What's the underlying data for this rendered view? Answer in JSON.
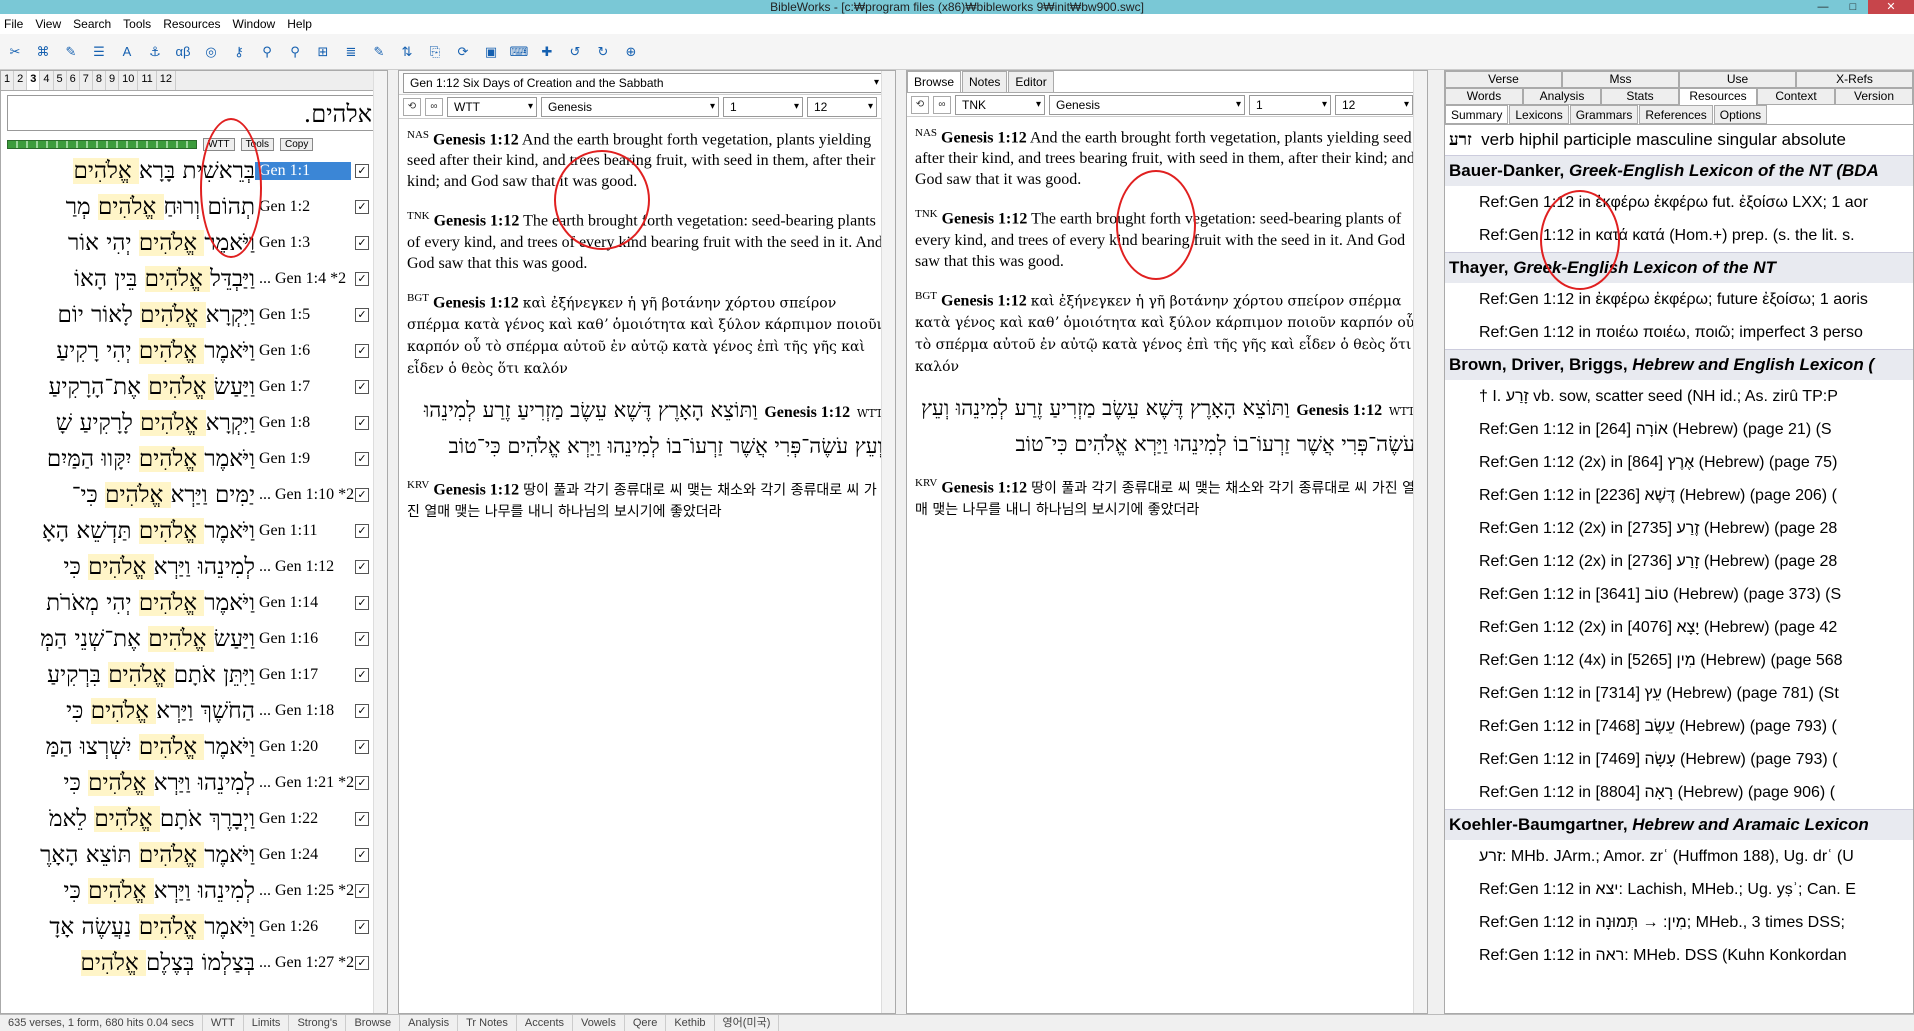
{
  "window": {
    "title": "BibleWorks - [c:₩program files (x86)₩bibleworks 9₩init₩bw900.swc]"
  },
  "menu": [
    "File",
    "View",
    "Search",
    "Tools",
    "Resources",
    "Window",
    "Help"
  ],
  "pane1": {
    "tabs": [
      "1",
      "2",
      "3",
      "4",
      "5",
      "6",
      "7",
      "8",
      "9",
      "10",
      "11",
      "12"
    ],
    "command": "אלהים.",
    "tools_label": "Tools",
    "copy_label": "Copy",
    "version_label": "WTT",
    "rows": [
      {
        "heb": "בְּרֵאשִׁית בָּרָא אֱלֹהִים",
        "ref": "Gen 1:1",
        "checked": true,
        "selected": true
      },
      {
        "heb": "תְהוֹם וְרוּחַ אֱלֹהִים מְרַ",
        "ref": "Gen 1:2",
        "checked": true
      },
      {
        "heb": "וַיֹּאמֶר אֱלֹהִים יְהִי אוֹר",
        "ref": "Gen 1:3",
        "checked": true
      },
      {
        "heb": "וַיַּבְדֵּל אֱלֹהִים בֵּין הָאוֹ",
        "ref": "... Gen 1:4 *2",
        "checked": true
      },
      {
        "heb": "וַיִּקְרָא אֱלֹהִים לָאוֹר יוֹם",
        "ref": "Gen 1:5",
        "checked": true
      },
      {
        "heb": "וַיֹּאמֶר אֱלֹהִים יְהִי רָקִיעַ",
        "ref": "Gen 1:6",
        "checked": true
      },
      {
        "heb": "וַיַּעַשׂ אֱלֹהִים אֶת־הָרָקִיעַ",
        "ref": "Gen 1:7",
        "checked": true
      },
      {
        "heb": "וַיִּקְרָא אֱלֹהִים לָרָקִיעַ שָׁ",
        "ref": "Gen 1:8",
        "checked": true
      },
      {
        "heb": "וַיֹּאמֶר אֱלֹהִים יִקָּווּ הַמַּיִם",
        "ref": "Gen 1:9",
        "checked": true
      },
      {
        "heb": "יַמִּים וַיַּרְא אֱלֹהִים כִּי־",
        "ref": "... Gen 1:10 *2",
        "checked": true
      },
      {
        "heb": "וַיֹּאמֶר אֱלֹהִים תַּדְשֵׁא הָאָ",
        "ref": "Gen 1:11",
        "checked": true
      },
      {
        "heb": "לְמִינֵהוּ וַיַּרְא אֱלֹהִים כִּי",
        "ref": "... Gen 1:12",
        "checked": true
      },
      {
        "heb": "וַיֹּאמֶר אֱלֹהִים יְהִי מְאֹרֹת",
        "ref": "Gen 1:14",
        "checked": true
      },
      {
        "heb": "וַיַּעַשׂ אֱלֹהִים אֶת־שְׁנֵי הַמְּ",
        "ref": "Gen 1:16",
        "checked": true
      },
      {
        "heb": "וַיִּתֵּן אֹתָם אֱלֹהִים בִּרְקִיעַ",
        "ref": "Gen 1:17",
        "checked": true
      },
      {
        "heb": "הַחֹשֶׁךְ וַיַּרְא אֱלֹהִים כִּי",
        "ref": "... Gen 1:18",
        "checked": true
      },
      {
        "heb": "וַיֹּאמֶר אֱלֹהִים יִשְׁרְצוּ הַמַּ",
        "ref": "Gen 1:20",
        "checked": true
      },
      {
        "heb": "לְמִינֵהוּ וַיַּרְא אֱלֹהִים כִּי",
        "ref": "... Gen 1:21 *2",
        "checked": true
      },
      {
        "heb": "וַיְבָרֶךְ אֹתָם אֱלֹהִים לֵאמֹ",
        "ref": "Gen 1:22",
        "checked": true
      },
      {
        "heb": "וַיֹּאמֶר אֱלֹהִים תּוֹצֵא הָאָרֶ",
        "ref": "Gen 1:24",
        "checked": true
      },
      {
        "heb": "לְמִינֵהוּ וַיַּרְא אֱלֹהִים כִּי",
        "ref": "... Gen 1:25 *2",
        "checked": true
      },
      {
        "heb": "וַיֹּאמֶר אֱלֹהִים נַעֲשֶׂה אָדָ",
        "ref": "Gen 1:26",
        "checked": true
      },
      {
        "heb": "בְּצַלְמוֹ בְּצֶלֶם אֱלֹהִים",
        "ref": "... Gen 1:27 *2",
        "checked": true
      }
    ]
  },
  "pane2": {
    "header": "Gen 1:12 Six Days of Creation and the Sabbath",
    "version": "WTT",
    "book": "Genesis",
    "chapter": "1",
    "verse": "12",
    "nas_label": "NAS",
    "nas_ref": "Genesis 1:12",
    "nas": "And the earth brought forth vegetation, plants yielding seed after their kind, and trees bearing fruit, with seed in them, after their kind; and God saw that it was good.",
    "tnk_label": "TNK",
    "tnk_ref": "Genesis 1:12",
    "tnk": "The earth brought forth vegetation: seed-bearing plants of every kind, and trees of every kind bearing fruit with the seed in it. And God saw that this was good.",
    "bgt_label": "BGT",
    "bgt_ref": "Genesis 1:12",
    "bgt": "καὶ ἐξήνεγκεν ἡ γῆ βοτάνην χόρτου σπείρον σπέρμα κατὰ γένος καὶ καθʼ ὁμοιότητα καὶ ξύλον κάρπιμον ποιοῦν καρπόν οὗ τὸ σπέρμα αὐτοῦ ἐν αὐτῷ κατὰ γένος ἐπὶ τῆς γῆς καὶ εἶδεν ὁ θεὸς ὅτι καλόν",
    "wtt_label": "WTT",
    "wtt_ref": "Genesis 1:12",
    "wtt": "וַתּוֹצֵא הָאָרֶץ דֶּשֶׁא עֵשֶׂב מַזְרִיעַ זֶרַע לְמִינֵהוּ וְעֵץ עֹשֶׂה־פְּרִי אֲשֶׁר זַרְעוֹ־בוֹ לְמִינֵהוּ וַיַּרְא אֱלֹהִים כִּי־טוֹב",
    "krv_label": "KRV",
    "krv_ref": "Genesis 1:12",
    "krv": "땅이 풀과 각기 종류대로 씨 맺는 채소와 각기 종류대로 씨 가진 열매 맺는 나무를 내니 하나님의 보시기에 좋았더라"
  },
  "pane3": {
    "tabs": [
      "Browse",
      "Notes",
      "Editor"
    ],
    "version": "TNK",
    "book": "Genesis",
    "chapter": "1",
    "verse": "12",
    "nas_label": "NAS",
    "nas_ref": "Genesis 1:12",
    "nas": "And the earth brought forth vegetation, plants yielding seed after their kind, and trees bearing fruit, with seed in them, after their kind; and God saw that it was good.",
    "tnk_label": "TNK",
    "tnk_ref": "Genesis 1:12",
    "tnk": "The earth brought forth vegetation: seed-bearing plants of every kind, and trees of every kind bearing fruit with the seed in it. And God saw that this was good.",
    "bgt_label": "BGT",
    "bgt_ref": "Genesis 1:12",
    "bgt": "καὶ ἐξήνεγκεν ἡ γῆ βοτάνην χόρτου σπείρον σπέρμα κατὰ γένος καὶ καθʼ ὁμοιότητα καὶ ξύλον κάρπιμον ποιοῦν καρπόν οὗ τὸ σπέρμα αὐτοῦ ἐν αὐτῷ κατὰ γένος ἐπὶ τῆς γῆς καὶ εἶδεν ὁ θεὸς ὅτι καλόν",
    "wtt_label": "WTT",
    "wtt_ref": "Genesis 1:12",
    "wtt": "וַתּוֹצֵא הָאָרֶץ דֶּשֶׁא עֵשֶׂב מַזְרִיעַ זֶרַע לְמִינֵהוּ וְעֵץ עֹשֶׂה־פְּרִי אֲשֶׁר זַרְעוֹ־בוֹ לְמִינֵהוּ וַיַּרְא אֱלֹהִים כִּי־טוֹב",
    "krv_label": "KRV",
    "krv_ref": "Genesis 1:12",
    "krv": "땅이 풀과 각기 종류대로 씨 맺는 채소와 각기 종류대로 씨 가진 열매 맺는 나무를 내니 하나님의 보시기에 좋았더라"
  },
  "pane4": {
    "tabs_row1": [
      "Verse",
      "Mss",
      "Use",
      "X-Refs"
    ],
    "tabs_row2": [
      "Words",
      "Analysis",
      "Stats",
      "Resources",
      "Context",
      "Version"
    ],
    "subtabs": [
      "Summary",
      "Lexicons",
      "Grammars",
      "References",
      "Options"
    ],
    "parse_word": "זרע",
    "parse": "verb hiphil participle masculine singular absolute",
    "sections": [
      {
        "title": "Bauer-Danker, ",
        "title_i": "Greek-English Lexicon of the NT (BDA",
        "lines": [
          "Ref:Gen 1:12 in ἐκφέρω ἐκφέρω fut. ἐξοίσω LXX; 1 aor",
          "Ref:Gen 1:12 in κατά κατά (Hom.+) prep. (s. the lit. s."
        ]
      },
      {
        "title": "Thayer, ",
        "title_i": "Greek-English Lexicon of the NT",
        "lines": [
          "Ref:Gen 1:12 in ἐκφέρω ἐκφέρω; future ἐξοίσω; 1 aoris",
          "Ref:Gen 1:12 in ποιέω ποιέω, ποιῶ; imperfect 3 perso"
        ]
      },
      {
        "title": "Brown, Driver, Briggs, ",
        "title_i": "Hebrew and English Lexicon (",
        "lines": [
          "† I. זָרַע vb. sow, scatter seed (NH id.; As. zirû TP:P",
          "Ref:Gen 1:12 in אוֹרָה   [264] (Hebrew) (page 21) (S",
          "Ref:Gen 1:12 (2x) in אֶרֶץ   [864] (Hebrew) (page 75)",
          "Ref:Gen 1:12 in דֶּשֶׁא   [2236] (Hebrew) (page 206) (",
          "Ref:Gen 1:12 (2x) in זֶרַע   [2735] (Hebrew) (page 28",
          "Ref:Gen 1:12 (2x) in זָרַע   [2736] (Hebrew) (page 28",
          "Ref:Gen 1:12 in טוֹב   [3641] (Hebrew) (page 373) (S",
          "Ref:Gen 1:12 (2x) in יָצָא   [4076] (Hebrew) (page 42",
          "Ref:Gen 1:12 (4x) in מִין   [5265] (Hebrew) (page 568",
          "Ref:Gen 1:12 in עֵץ   [7314] (Hebrew) (page 781) (St",
          "Ref:Gen 1:12 in עֵשֶׂב   [7468] (Hebrew) (page 793) (",
          "Ref:Gen 1:12 in עָשָׂה   [7469] (Hebrew) (page 793) (",
          "Ref:Gen 1:12 in רָאָה   [8804] (Hebrew) (page 906) ("
        ]
      },
      {
        "title": "Koehler-Baumgartner, ",
        "title_i": "Hebrew and Aramaic Lexicon",
        "lines": [
          "זרע: MHb. JArm.; Amor. zrʿ (Huffmon 188), Ug. drʿ (U",
          "Ref:Gen 1:12 in יצא: Lachish, MHeb.; Ug. yṣʾ; Can. E",
          "Ref:Gen 1:12 in מִין: → תְּמוּנָה; MHeb., 3 times DSS;",
          "Ref:Gen 1:12 in ראה: MHeb. DSS (Kuhn Konkordan"
        ]
      }
    ]
  },
  "status": [
    "635 verses, 1 form, 680 hits 0.04 secs",
    "WTT",
    "Limits",
    "Strong's",
    "Browse",
    "Analysis",
    "Tr Notes",
    "Accents",
    "Vowels",
    "Qere",
    "Kethib",
    "영어(미국)"
  ],
  "annotations": [
    "1",
    "2",
    "3",
    "4"
  ]
}
